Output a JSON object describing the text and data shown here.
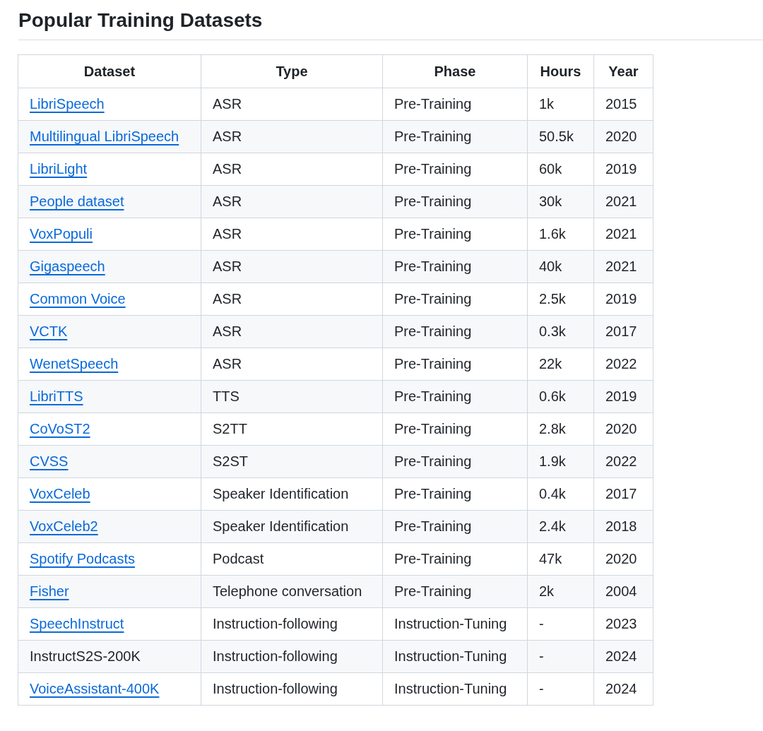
{
  "heading": "Popular Training Datasets",
  "table": {
    "columns": [
      "Dataset",
      "Type",
      "Phase",
      "Hours",
      "Year"
    ],
    "rows": [
      {
        "dataset": "LibriSpeech",
        "link": true,
        "type": "ASR",
        "phase": "Pre-Training",
        "hours": "1k",
        "year": "2015"
      },
      {
        "dataset": "Multilingual LibriSpeech",
        "link": true,
        "type": "ASR",
        "phase": "Pre-Training",
        "hours": "50.5k",
        "year": "2020"
      },
      {
        "dataset": "LibriLight",
        "link": true,
        "type": "ASR",
        "phase": "Pre-Training",
        "hours": "60k",
        "year": "2019"
      },
      {
        "dataset": "People dataset",
        "link": true,
        "type": "ASR",
        "phase": "Pre-Training",
        "hours": "30k",
        "year": "2021"
      },
      {
        "dataset": "VoxPopuli",
        "link": true,
        "type": "ASR",
        "phase": "Pre-Training",
        "hours": "1.6k",
        "year": "2021"
      },
      {
        "dataset": "Gigaspeech",
        "link": true,
        "type": "ASR",
        "phase": "Pre-Training",
        "hours": "40k",
        "year": "2021"
      },
      {
        "dataset": "Common Voice",
        "link": true,
        "type": "ASR",
        "phase": "Pre-Training",
        "hours": "2.5k",
        "year": "2019"
      },
      {
        "dataset": "VCTK",
        "link": true,
        "type": "ASR",
        "phase": "Pre-Training",
        "hours": "0.3k",
        "year": "2017"
      },
      {
        "dataset": "WenetSpeech",
        "link": true,
        "type": "ASR",
        "phase": "Pre-Training",
        "hours": "22k",
        "year": "2022"
      },
      {
        "dataset": "LibriTTS",
        "link": true,
        "type": "TTS",
        "phase": "Pre-Training",
        "hours": "0.6k",
        "year": "2019"
      },
      {
        "dataset": "CoVoST2",
        "link": true,
        "type": "S2TT",
        "phase": "Pre-Training",
        "hours": "2.8k",
        "year": "2020"
      },
      {
        "dataset": "CVSS",
        "link": true,
        "type": "S2ST",
        "phase": "Pre-Training",
        "hours": "1.9k",
        "year": "2022"
      },
      {
        "dataset": "VoxCeleb",
        "link": true,
        "type": "Speaker Identification",
        "phase": "Pre-Training",
        "hours": "0.4k",
        "year": "2017"
      },
      {
        "dataset": "VoxCeleb2",
        "link": true,
        "type": "Speaker Identification",
        "phase": "Pre-Training",
        "hours": "2.4k",
        "year": "2018"
      },
      {
        "dataset": "Spotify Podcasts",
        "link": true,
        "type": "Podcast",
        "phase": "Pre-Training",
        "hours": "47k",
        "year": "2020"
      },
      {
        "dataset": "Fisher",
        "link": true,
        "type": "Telephone conversation",
        "phase": "Pre-Training",
        "hours": "2k",
        "year": "2004"
      },
      {
        "dataset": "SpeechInstruct",
        "link": true,
        "type": "Instruction-following",
        "phase": "Instruction-Tuning",
        "hours": "-",
        "year": "2023"
      },
      {
        "dataset": "InstructS2S-200K",
        "link": false,
        "type": "Instruction-following",
        "phase": "Instruction-Tuning",
        "hours": "-",
        "year": "2024"
      },
      {
        "dataset": "VoiceAssistant-400K",
        "link": true,
        "type": "Instruction-following",
        "phase": "Instruction-Tuning",
        "hours": "-",
        "year": "2024"
      }
    ]
  }
}
